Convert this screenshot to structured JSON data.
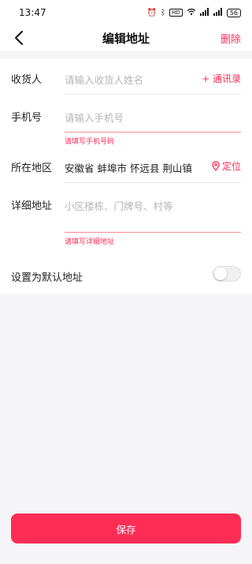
{
  "status_bar": {
    "time": "13:47",
    "battery": "56",
    "network": "HD"
  },
  "header": {
    "title": "编辑地址",
    "delete_label": "删除"
  },
  "form": {
    "recipient": {
      "label": "收货人",
      "placeholder": "请输入收货人姓名",
      "action": "+ 通讯录"
    },
    "phone": {
      "label": "手机号",
      "placeholder": "请输入手机号",
      "error": "请填写手机号码"
    },
    "region": {
      "label": "所在地区",
      "value": "安徽省 蚌埠市 怀远县 荆山镇",
      "action": "定位"
    },
    "address": {
      "label": "详细地址",
      "placeholder": "小区楼栋、门牌号、村等",
      "error": "请填写详细地址"
    },
    "default": {
      "label": "设置为默认地址",
      "enabled": false
    }
  },
  "footer": {
    "save_label": "保存"
  },
  "colors": {
    "accent": "#ff2d55",
    "error_line": "#f09090"
  }
}
